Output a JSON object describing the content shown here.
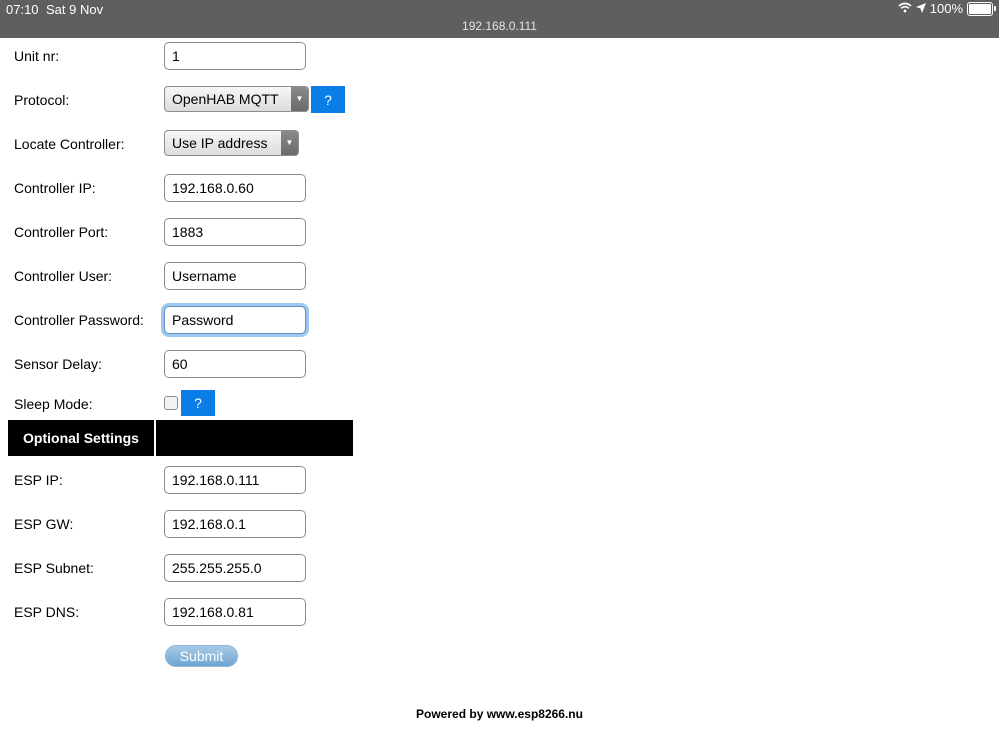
{
  "status_bar": {
    "time": "07:10",
    "date": "Sat 9 Nov",
    "url": "192.168.0.111",
    "battery": "100%"
  },
  "form": {
    "unit_nr": {
      "label": "Unit nr:",
      "value": "1"
    },
    "protocol": {
      "label": "Protocol:",
      "value": "OpenHAB MQTT",
      "help": "?"
    },
    "locate_controller": {
      "label": "Locate Controller:",
      "value": "Use IP address"
    },
    "controller_ip": {
      "label": "Controller IP:",
      "value": "192.168.0.60"
    },
    "controller_port": {
      "label": "Controller Port:",
      "value": "1883"
    },
    "controller_user": {
      "label": "Controller User:",
      "value": "Username"
    },
    "controller_password": {
      "label": "Controller Password:",
      "value": "Password"
    },
    "sensor_delay": {
      "label": "Sensor Delay:",
      "value": "60"
    },
    "sleep_mode": {
      "label": "Sleep Mode:",
      "checked": false,
      "help": "?"
    }
  },
  "optional": {
    "header": "Optional Settings",
    "esp_ip": {
      "label": "ESP IP:",
      "value": "192.168.0.111"
    },
    "esp_gw": {
      "label": "ESP GW:",
      "value": "192.168.0.1"
    },
    "esp_subnet": {
      "label": "ESP Subnet:",
      "value": "255.255.255.0"
    },
    "esp_dns": {
      "label": "ESP DNS:",
      "value": "192.168.0.81"
    }
  },
  "submit_label": "Submit",
  "footer": "Powered by www.esp8266.nu",
  "colors": {
    "status_bar": "#5f5f5f",
    "help_button": "#0a7ee6",
    "header_bg": "#000000",
    "submit": "#6da3cf"
  }
}
